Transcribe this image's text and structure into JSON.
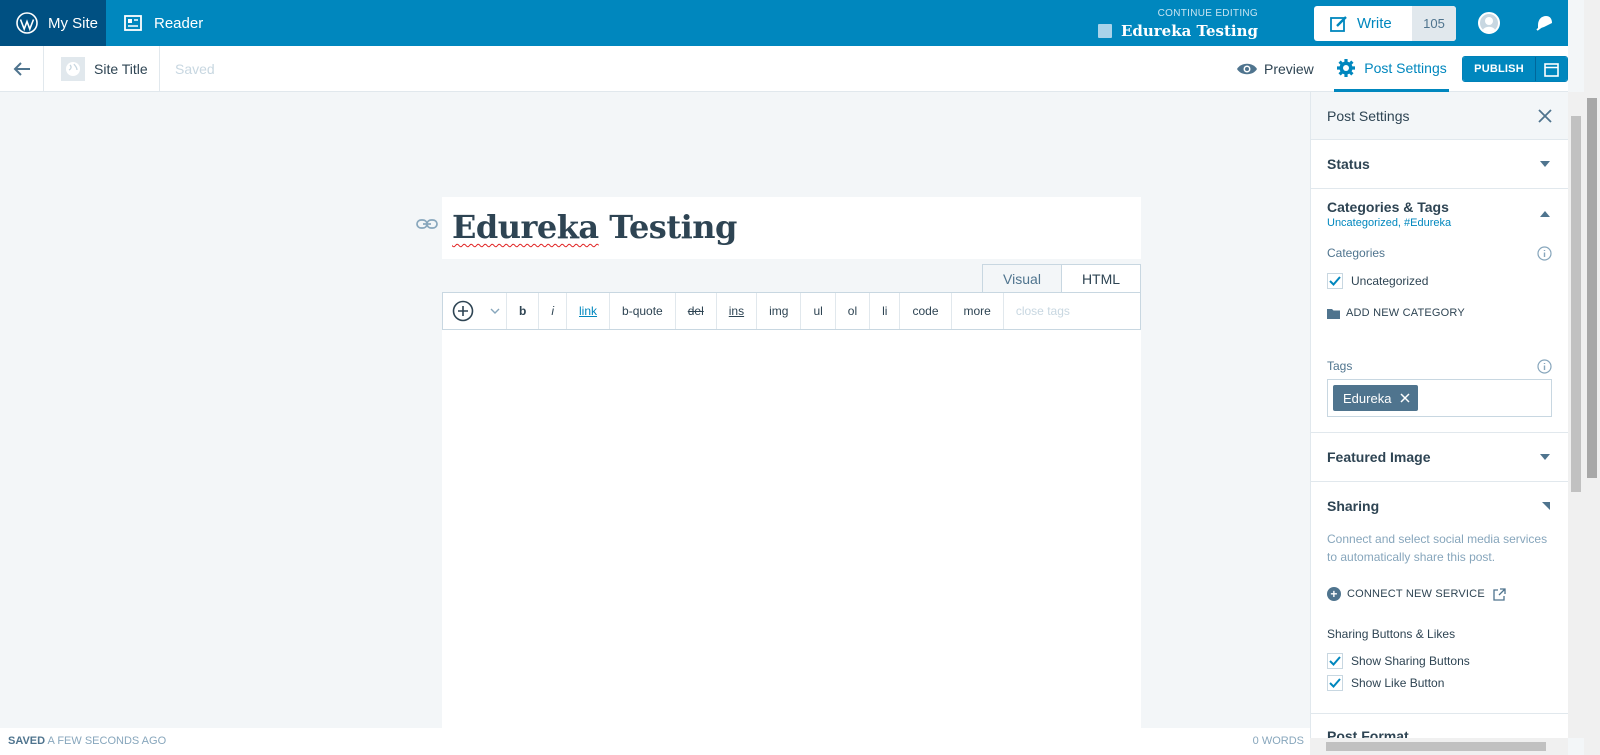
{
  "masterbar": {
    "my_site": "My Site",
    "reader": "Reader",
    "continue_label": "CONTINUE EDITING",
    "continue_title": "Edureka Testing",
    "write_label": "Write",
    "write_count": "105"
  },
  "editor_bar": {
    "site_title": "Site Title",
    "save_status": "Saved",
    "preview": "Preview",
    "post_settings": "Post Settings",
    "publish": "PUBLISH"
  },
  "post": {
    "title_word1": "Edureka",
    "title_word2": "Testing"
  },
  "editor": {
    "tabs": [
      "Visual",
      "HTML"
    ],
    "toolbar": [
      "b",
      "i",
      "link",
      "b-quote",
      "del",
      "ins",
      "img",
      "ul",
      "ol",
      "li",
      "code",
      "more",
      "close tags"
    ]
  },
  "footer": {
    "saved": "SAVED",
    "saved_time": "A FEW SECONDS AGO",
    "words": "0 WORDS"
  },
  "sidebar": {
    "heading": "Post Settings",
    "status": "Status",
    "categories_tags": "Categories & Tags",
    "categories_tags_sub": "Uncategorized, #Edureka",
    "categories_label": "Categories",
    "category_item": "Uncategorized",
    "add_category": "ADD NEW CATEGORY",
    "tags_label": "Tags",
    "tag": "Edureka",
    "featured_image": "Featured Image",
    "sharing": "Sharing",
    "sharing_desc": "Connect and select social media services to automatically share this post.",
    "connect_service": "CONNECT NEW SERVICE",
    "sharing_buttons_label": "Sharing Buttons & Likes",
    "show_sharing": "Show Sharing Buttons",
    "show_like": "Show Like Button",
    "next_section_partial": "Post Format"
  },
  "colors": {
    "masterbar": "#0087be",
    "masterbar_active": "#005082",
    "accent": "#0087be",
    "text": "#2e4453"
  }
}
